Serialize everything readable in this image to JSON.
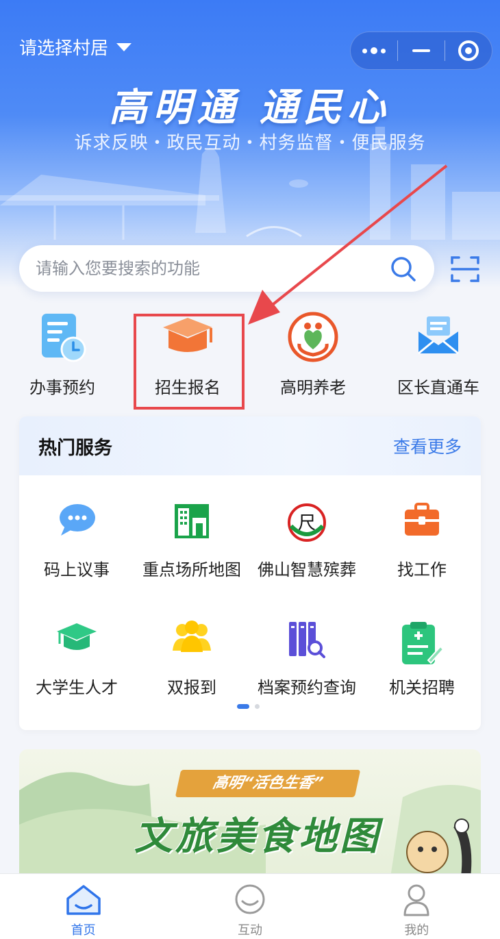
{
  "header": {
    "village_selector": "请选择村居",
    "hero_title": "高明通 通民心",
    "hero_subtitle": "诉求反映・政民互动・村务监督・便民服务"
  },
  "search": {
    "placeholder": "请输入您要搜索的功能"
  },
  "quick_actions": [
    {
      "label": "办事预约",
      "icon": "calendar-clock-icon"
    },
    {
      "label": "招生报名",
      "icon": "graduation-cap-icon"
    },
    {
      "label": "高明养老",
      "icon": "elderly-care-icon"
    },
    {
      "label": "区长直通车",
      "icon": "mail-icon"
    }
  ],
  "hot_services": {
    "title": "热门服务",
    "more_label": "查看更多",
    "items": [
      {
        "label": "码上议事",
        "icon": "chat-bubble-icon"
      },
      {
        "label": "重点场所地图",
        "icon": "building-map-icon"
      },
      {
        "label": "佛山智慧殡葬",
        "icon": "funeral-service-icon"
      },
      {
        "label": "找工作",
        "icon": "briefcase-icon"
      },
      {
        "label": "大学生人才",
        "icon": "graduate-cap-icon"
      },
      {
        "label": "双报到",
        "icon": "people-icon"
      },
      {
        "label": "档案预约查询",
        "icon": "archive-search-icon"
      },
      {
        "label": "机关招聘",
        "icon": "clipboard-plus-icon"
      }
    ],
    "page_count": 2,
    "current_page": 1
  },
  "banner": {
    "tag": "高明“活色生香”",
    "title": "文旅美食地图"
  },
  "tabbar": [
    {
      "label": "首页",
      "icon": "home-icon",
      "active": true
    },
    {
      "label": "互动",
      "icon": "interaction-icon",
      "active": false
    },
    {
      "label": "我的",
      "icon": "user-icon",
      "active": false
    }
  ],
  "colors": {
    "primary": "#2f74ea",
    "highlight_box": "#e8484c",
    "annotation_arrow": "#e8484c"
  }
}
